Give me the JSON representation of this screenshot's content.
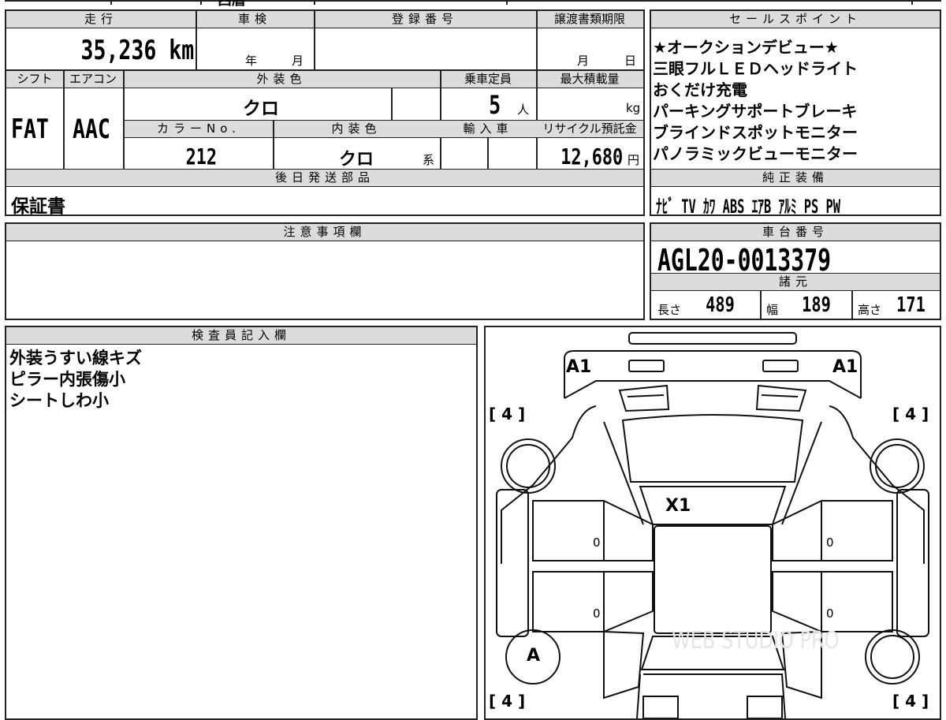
{
  "top_partial": "西暦",
  "headers": {
    "mileage": "走行",
    "shaken": "車検",
    "registration": "登録番号",
    "transfer_deadline": "譲渡書類期限",
    "shift": "シフト",
    "aircon": "エアコン",
    "exterior_color": "外装色",
    "capacity": "乗車定員",
    "max_load": "最大積載量",
    "color_no": "カラーNo.",
    "interior_color": "内装色",
    "import": "輸入車",
    "recycle": "リサイクル預託金",
    "later_parts": "後日発送部品",
    "sales_points": "セールスポイント",
    "genuine_equipment": "純正装備",
    "caution": "注意事項欄",
    "chassis_no": "車台番号",
    "specs": "諸元",
    "inspector": "検査員記入欄"
  },
  "values": {
    "mileage": "35,236 km",
    "year_unit": "年",
    "month_unit": "月",
    "month_unit2": "月",
    "day_unit": "日",
    "shift": "FAT",
    "aircon": "AAC",
    "exterior_color": "クロ",
    "capacity": "5",
    "capacity_unit": "人",
    "load_unit": "kg",
    "color_no": "212",
    "interior_color": "クロ",
    "interior_suffix": "系",
    "recycle": "12,680",
    "recycle_unit": "円",
    "later_parts": "保証書",
    "equipment": "ﾅﾋﾞ TV ｶﾜ ABS ｴｱB ｱﾙﾐ PS PW",
    "chassis_no": "AGL20-0013379",
    "length_label": "長さ",
    "length": "489",
    "width_label": "幅",
    "width": "189",
    "height_label": "高さ",
    "height": "171"
  },
  "sales_points": [
    "★オークションデビュー★",
    "三眼フルＬＥＤヘッドライト",
    "おくだけ充電",
    "パーキングサポートブレーキ",
    "ブラインドスポットモニター",
    "パノラミックビューモニター"
  ],
  "inspector_notes": [
    "外装うすい線キズ",
    "ピラー内張傷小",
    "シートしわ小"
  ],
  "diagram": {
    "mark_a1_left": "A1",
    "mark_a1_right": "A1",
    "mark_x1": "X1",
    "mark_a": "A",
    "tire_fl": "[ 4 ]",
    "tire_fr": "[ 4 ]",
    "tire_rl": "[ 4 ]",
    "tire_rr": "[ 4 ]",
    "door_fl": "0",
    "door_fr": "0",
    "door_rl": "0",
    "door_rr": "0"
  },
  "watermark": "WEB STUDIO PRO"
}
